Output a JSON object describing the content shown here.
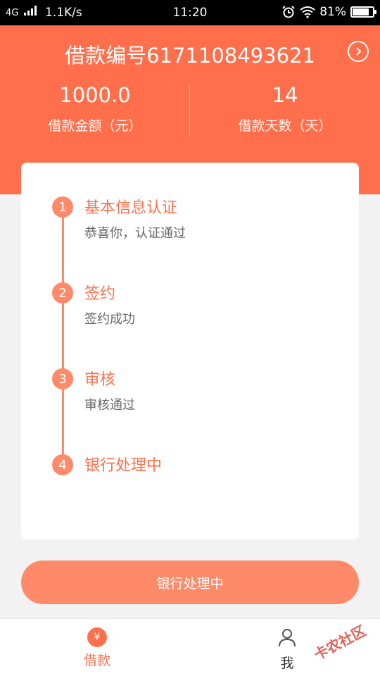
{
  "status_bar": {
    "network": "4G",
    "speed": "1.1K/s",
    "time": "11:20",
    "battery": "81%",
    "battery_level": 0.81
  },
  "header": {
    "loan_number": "借款编号6171108493621",
    "amount_value": "1000.0",
    "amount_label": "借款金额（元）",
    "days_value": "14",
    "days_label": "借款天数（天）"
  },
  "steps": [
    {
      "number": "1",
      "title": "基本信息认证",
      "desc": "恭喜你，认证通过"
    },
    {
      "number": "2",
      "title": "签约",
      "desc": "签约成功"
    },
    {
      "number": "3",
      "title": "审核",
      "desc": "审核通过"
    },
    {
      "number": "4",
      "title": "银行处理中",
      "desc": ""
    }
  ],
  "bottom_button": "银行处理中",
  "tabbar": {
    "loan_icon": "¥",
    "loan_label": "借款",
    "me_label": "我"
  },
  "watermark": "卡农社区",
  "colors": {
    "accent": "#ff6f4b",
    "accent_light": "#ff8a6a"
  },
  "icons": {
    "arrow": "chevron-right-circle-icon",
    "alarm": "alarm-icon",
    "wifi": "wifi-icon",
    "battery": "battery-icon",
    "signal": "signal-icon",
    "user": "user-icon",
    "yen": "yen-icon"
  }
}
